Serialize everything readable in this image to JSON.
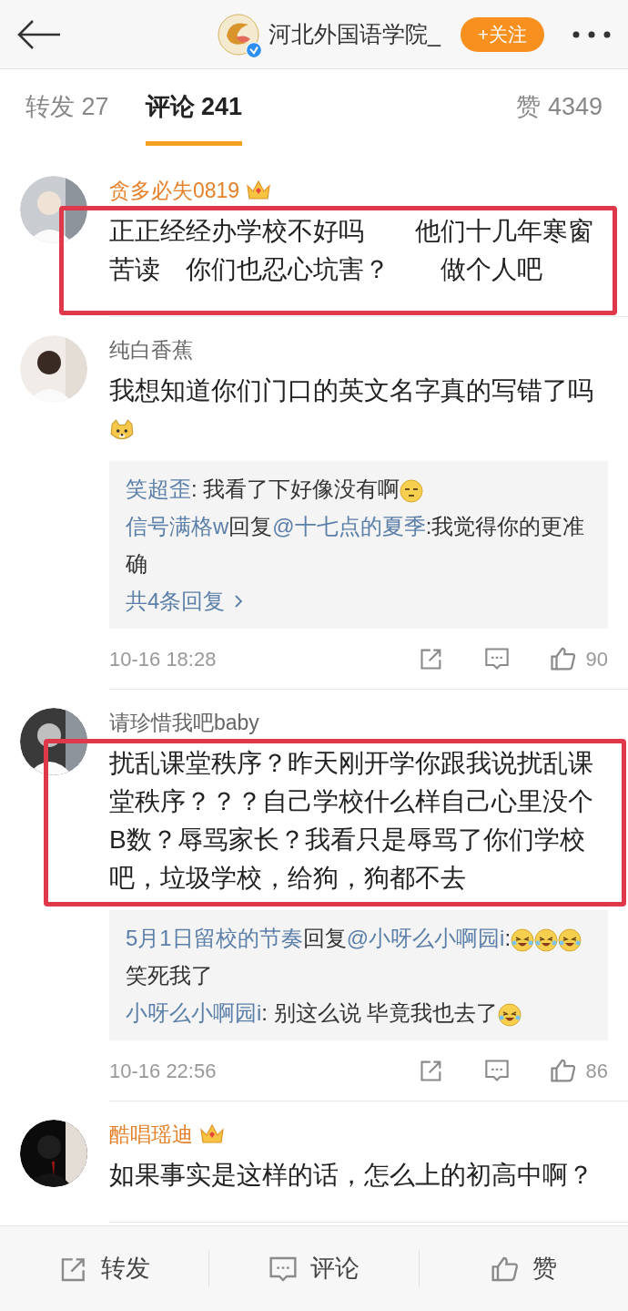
{
  "header": {
    "title": "河北外国语学院_",
    "verified": true,
    "follow_button": "+关注"
  },
  "tabs": [
    {
      "label": "转发 27",
      "selected": false
    },
    {
      "label": "评论 241",
      "selected": true
    },
    {
      "label": "赞 4349",
      "selected": false
    }
  ],
  "comments": [
    {
      "user": "贪多必失0819",
      "vip": true,
      "highlighted": true,
      "text": "正正经经办学校不好吗　　他们十几年寒窗苦读　你们也忍心坑害？　　做个人吧"
    },
    {
      "user": "纯白香蕉",
      "vip": false,
      "highlighted": false,
      "text": "我想知道你们门口的英文名字真的写错了吗",
      "trailing_emoji": {
        "kind": "doge"
      },
      "replies": [
        [
          {
            "kind": "user",
            "text": "笑超歪"
          },
          {
            "kind": "text",
            "text": ": 我看了下好像没有啊"
          },
          {
            "kind": "squint"
          }
        ],
        [
          {
            "kind": "user",
            "text": "信号满格w"
          },
          {
            "kind": "text",
            "text": "回复"
          },
          {
            "kind": "user",
            "text": "@十七点的夏季"
          },
          {
            "kind": "text",
            "text": ":我觉得你的更准确"
          }
        ]
      ],
      "more_replies": "共4条回复",
      "time": "10-16 18:28",
      "likes": "90"
    },
    {
      "user": "请珍惜我吧baby",
      "vip": false,
      "highlighted": true,
      "text": "扰乱课堂秩序？昨天刚开学你跟我说扰乱课堂秩序？？？自己学校什么样自己心里没个B数？辱骂家长？我看只是辱骂了你们学校吧，垃圾学校，给狗，狗都不去",
      "replies": [
        [
          {
            "kind": "user",
            "text": "5月1日留校的节奏"
          },
          {
            "kind": "text",
            "text": "回复"
          },
          {
            "kind": "user",
            "text": "@小呀么小啊园i"
          },
          {
            "kind": "text",
            "text": ":"
          },
          {
            "kind": "laugh"
          },
          {
            "kind": "laugh"
          },
          {
            "kind": "laugh"
          },
          {
            "kind": "text",
            "text": "笑死我了"
          }
        ],
        [
          {
            "kind": "user",
            "text": "小呀么小啊园i"
          },
          {
            "kind": "text",
            "text": ": 别这么说 毕竟我也去了"
          },
          {
            "kind": "laugh"
          }
        ]
      ],
      "time": "10-16 22:56",
      "likes": "86"
    },
    {
      "user": "酷唱瑶迪",
      "vip": true,
      "highlighted": false,
      "text": "如果事实是这样的话，怎么上的初高中啊？"
    }
  ],
  "bottom_bar": [
    "转发",
    "评论",
    "赞"
  ]
}
